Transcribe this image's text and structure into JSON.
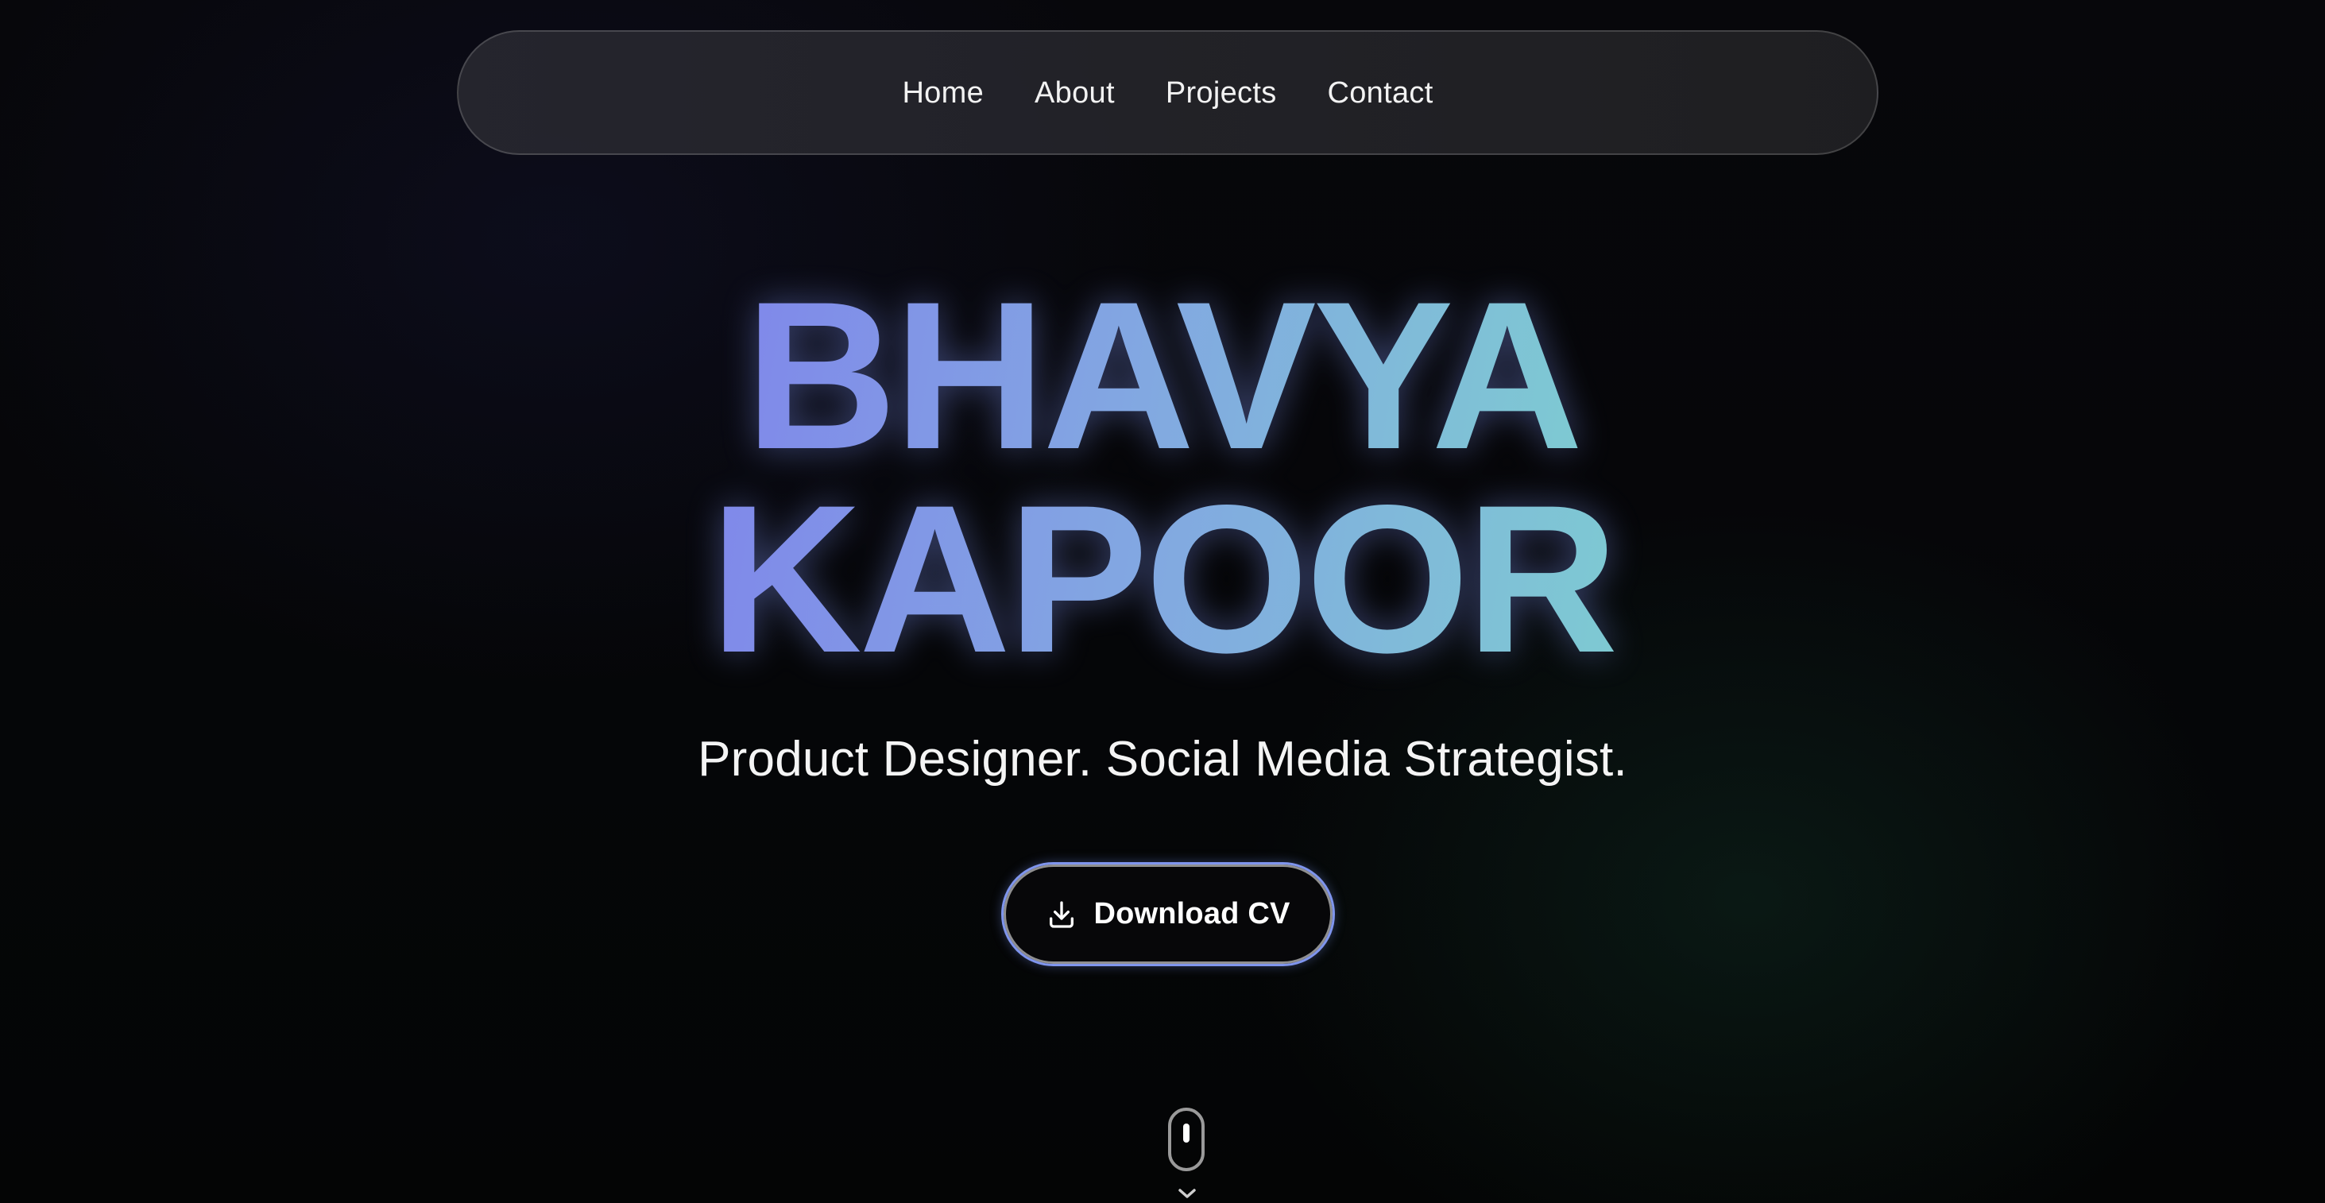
{
  "nav": {
    "items": [
      {
        "label": "Home"
      },
      {
        "label": "About"
      },
      {
        "label": "Projects"
      },
      {
        "label": "Contact"
      }
    ]
  },
  "hero": {
    "name_line1": "BHAVYA",
    "name_line2": "KAPOOR",
    "tagline": "Product Designer. Social Media Strategist."
  },
  "cta": {
    "label": "Download CV",
    "icon": "download-icon",
    "border_color": "#7f95ee"
  },
  "scroll_indicator": {
    "icons": [
      "mouse-icon",
      "chevron-down-icon"
    ]
  },
  "colors": {
    "background": "#050507",
    "name_gradient_start": "#8088ea",
    "name_gradient_mid": "#82a6e2",
    "name_gradient_end": "#7ecad2",
    "nav_background": "#28282e"
  }
}
